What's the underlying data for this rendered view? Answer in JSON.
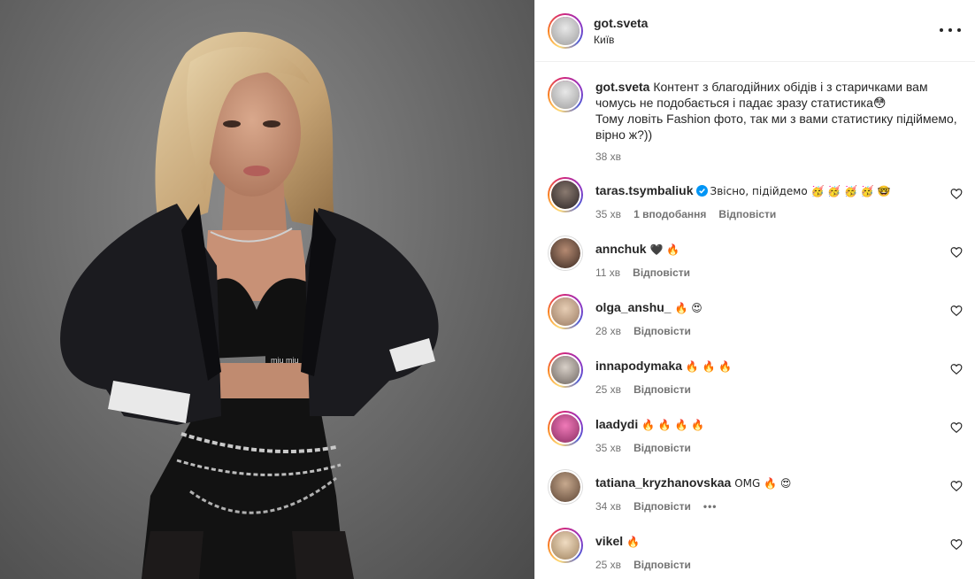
{
  "post": {
    "username": "got.sveta",
    "location": "Київ"
  },
  "caption": {
    "username": "got.sveta",
    "text": "Контент з благодійних обідів і з старичками вам чомусь не подобається і падає зразу статистика😳",
    "text2": "Тому ловіть Fashion фото, так ми з вами статистику підіймемо, вірно ж?))",
    "time": "38 хв"
  },
  "comments": [
    {
      "username": "taras.tsymbaliuk",
      "verified": true,
      "text": "Звісно, підійдемо 🥳 🥳 🥳 🥳 🤓",
      "time": "35 хв",
      "likes": "1 вподобання",
      "reply": "Відповісти"
    },
    {
      "username": "annchuk",
      "text": "🖤 🔥",
      "time": "11 хв",
      "reply": "Відповісти"
    },
    {
      "username": "olga_anshu_",
      "text": "🔥 😍",
      "time": "28 хв",
      "reply": "Відповісти"
    },
    {
      "username": "innapodymaka",
      "text": "🔥 🔥 🔥",
      "time": "25 хв",
      "reply": "Відповісти"
    },
    {
      "username": "laadydi",
      "text": "🔥 🔥 🔥 🔥",
      "time": "35 хв",
      "reply": "Відповісти"
    },
    {
      "username": "tatiana_kryzhanovskaa",
      "text": "OMG 🔥 😍",
      "time": "34 хв",
      "reply": "Відповісти",
      "more": "•••"
    },
    {
      "username": "vikel",
      "text": "🔥",
      "time": "25 хв",
      "reply": "Відповісти"
    }
  ],
  "photo": {
    "logo_text": "miu miu"
  },
  "icons": {
    "more": "more-horizontal-icon",
    "heart": "heart-outline-icon",
    "verified": "verified-badge-icon"
  },
  "colors": {
    "verified": "#0095f6",
    "muted": "#737373",
    "text": "#262626"
  }
}
